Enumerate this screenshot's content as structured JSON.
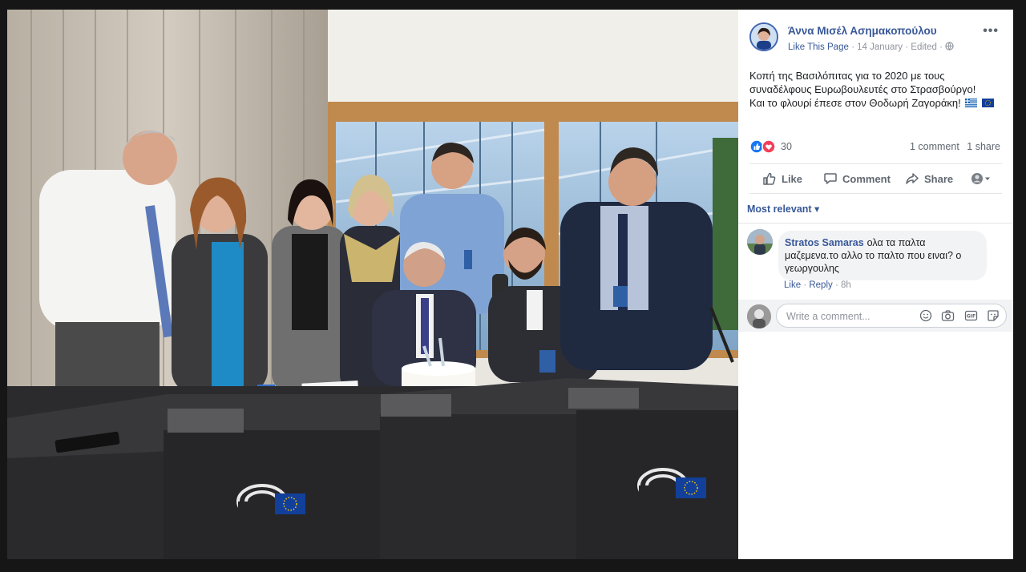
{
  "post": {
    "page_name": "Άννα Μισέλ Ασημακοπούλου",
    "like_page": "Like This Page",
    "separator": "·",
    "date": "14 January",
    "edited": "Edited",
    "text_line1": "Κοπή της Βασιλόπιτας για το 2020 με τους",
    "text_line2": "συναδέλφους Ευρωβουλευτές στο Στρασβούργο!",
    "text_line3": "Και το φλουρί έπεσε στον Θοδωρή Ζαγοράκη!"
  },
  "reactions": {
    "count": "30",
    "comments": "1 comment",
    "shares": "1 share"
  },
  "actions": {
    "like": "Like",
    "comment": "Comment",
    "share": "Share"
  },
  "comments": {
    "sort_label": "Most relevant ▾",
    "items": [
      {
        "author": "Stratos Samaras",
        "text": "ολα τα παλτα μαζεμενα.το αλλο το παλτο που ειναι? ο γεωργουλης",
        "like": "Like",
        "reply": "Reply",
        "time": "8h"
      }
    ],
    "write_placeholder": "Write a comment..."
  },
  "colors": {
    "link": "#385898",
    "like_blue": "#1877f2",
    "love_red": "#f33e58",
    "eu_blue": "#123f9a"
  }
}
